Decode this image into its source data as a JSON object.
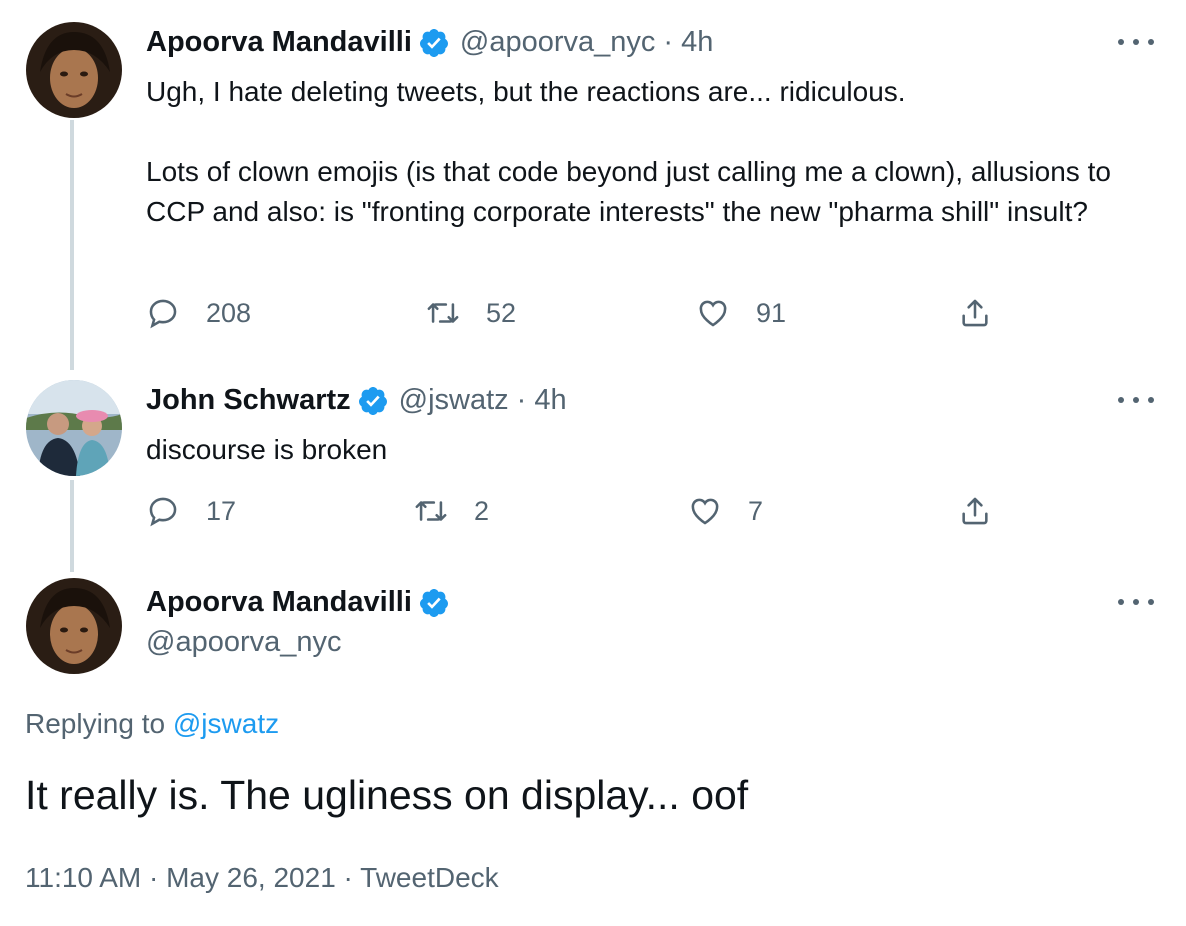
{
  "tweet1": {
    "name": "Apoorva Mandavilli",
    "handle": "@apoorva_nyc",
    "separator": "·",
    "time": "4h",
    "text": "Ugh, I hate deleting tweets, but the reactions are... ridiculous.\n\nLots of clown emojis (is that code beyond just calling me a clown), allusions to CCP and also: is \"fronting corporate interests\" the new \"pharma shill\" insult?",
    "replies": "208",
    "retweets": "52",
    "likes": "91"
  },
  "tweet2": {
    "name": "John Schwartz",
    "handle": "@jswatz",
    "separator": "·",
    "time": "4h",
    "text": "discourse is broken",
    "replies": "17",
    "retweets": "2",
    "likes": "7"
  },
  "main_tweet": {
    "name": "Apoorva Mandavilli",
    "handle": "@apoorva_nyc",
    "replying_prefix": "Replying to",
    "replying_to": "@jswatz",
    "text": "It really is. The ugliness on display... oof",
    "meta": "11:10 AM · May 26, 2021 · TweetDeck"
  },
  "icons": {
    "verified": "verified-badge-icon",
    "reply": "reply-icon",
    "retweet": "retweet-icon",
    "like": "heart-icon",
    "share": "share-icon",
    "more": "more-options-icon"
  },
  "colors": {
    "text": "#0f1419",
    "secondary": "#536471",
    "accent": "#1d9bf0",
    "thread_line": "#cfd9de"
  }
}
